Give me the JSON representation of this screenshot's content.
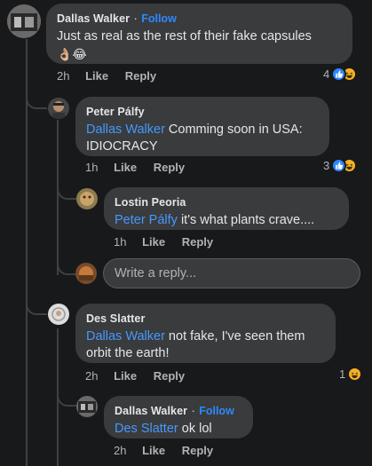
{
  "comments": [
    {
      "author": "Dallas Walker",
      "follow": "Follow",
      "separator": "·",
      "text": "Just as real as the rest of their fake capsules",
      "emoji_line": "👌🏼😂",
      "time": "2h",
      "like_label": "Like",
      "reply_label": "Reply",
      "reaction_count": "4"
    },
    {
      "author": "Peter Pálfy",
      "mention": "Dallas Walker",
      "text": " Comming soon in USA: IDIOCRACY",
      "time": "1h",
      "like_label": "Like",
      "reply_label": "Reply",
      "reaction_count": "3"
    },
    {
      "author": "Lostin Peoria",
      "mention": "Peter Pálfy",
      "text": " it's what plants crave....",
      "time": "1h",
      "like_label": "Like",
      "reply_label": "Reply"
    },
    {
      "author": "Des Slatter",
      "mention": "Dallas Walker",
      "text": " not fake, I've seen them orbit the earth!",
      "time": "2h",
      "like_label": "Like",
      "reply_label": "Reply",
      "reaction_count": "1"
    },
    {
      "author": "Dallas Walker",
      "follow": "Follow",
      "separator": "·",
      "mention": "Des Slatter",
      "text": " ok lol",
      "time": "2h",
      "like_label": "Like",
      "reply_label": "Reply"
    }
  ],
  "reply_box": {
    "placeholder": "Write a reply..."
  },
  "colors": {
    "background": "#18191a",
    "bubble": "#3a3b3c",
    "link": "#2d88ff",
    "like": "#2d88ff",
    "haha": "#f7b125"
  },
  "icons": [
    "like-reaction-icon",
    "haha-reaction-icon",
    "ok-hand-emoji",
    "laughing-emoji"
  ]
}
